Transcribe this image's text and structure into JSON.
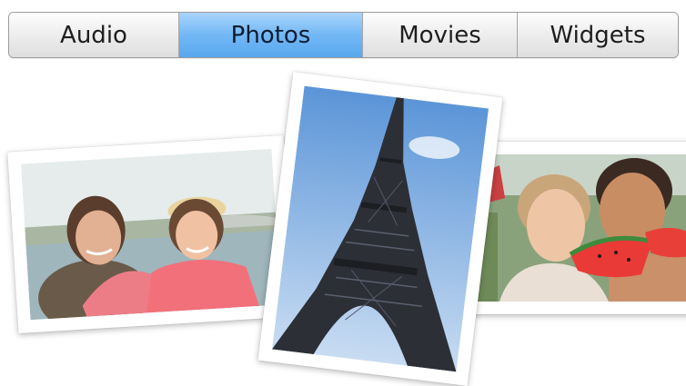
{
  "tabs": [
    {
      "label": "Audio",
      "selected": false
    },
    {
      "label": "Photos",
      "selected": true
    },
    {
      "label": "Movies",
      "selected": false
    },
    {
      "label": "Widgets",
      "selected": false
    }
  ],
  "colors": {
    "selected_tab": "#73b8f5",
    "tab_border": "#9c9c9c",
    "background": "#ffffff"
  }
}
